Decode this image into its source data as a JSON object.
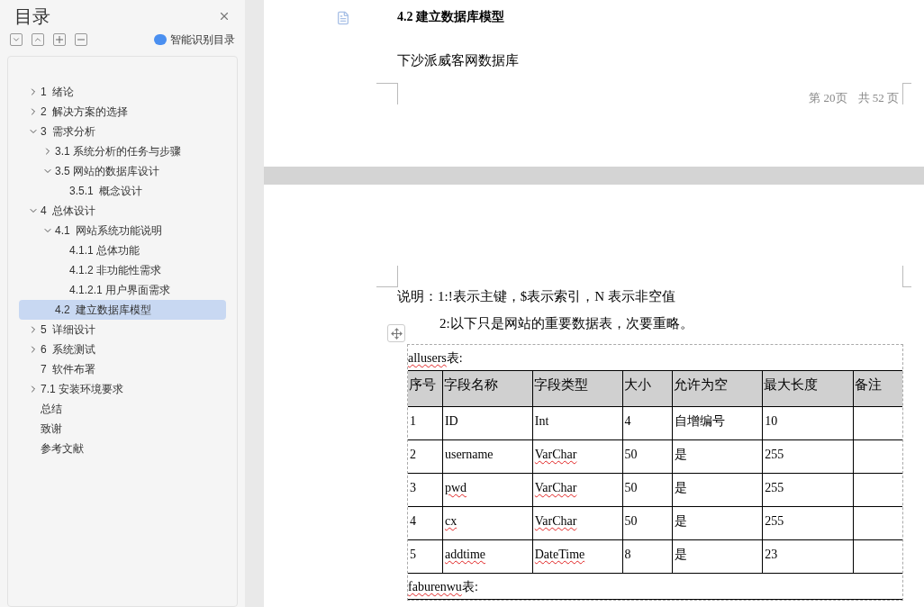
{
  "sidebar": {
    "title": "目录",
    "smart_toc_button": "智能识别目录",
    "toc": [
      {
        "label": "1  绪论",
        "expanded": false,
        "selected": false
      },
      {
        "label": "2  解决方案的选择",
        "expanded": false,
        "selected": false
      },
      {
        "label": "3  需求分析",
        "expanded": true,
        "selected": false,
        "children": [
          {
            "label": "3.1 系统分析的任务与步骤",
            "expanded": false,
            "selected": false
          },
          {
            "label": "3.5 网站的数据库设计",
            "expanded": true,
            "selected": false,
            "children": [
              {
                "label": "3.5.1  概念设计",
                "selected": false
              }
            ]
          }
        ]
      },
      {
        "label": "4  总体设计",
        "expanded": true,
        "selected": false,
        "children": [
          {
            "label": "4.1  网站系统功能说明",
            "expanded": true,
            "selected": false,
            "children": [
              {
                "label": "4.1.1 总体功能",
                "selected": false
              },
              {
                "label": "4.1.2 非功能性需求",
                "selected": false
              },
              {
                "label": "4.1.2.1 用户界面需求",
                "selected": false
              }
            ]
          },
          {
            "label": "4.2  建立数据库模型",
            "selected": true
          }
        ]
      },
      {
        "label": "5  详细设计",
        "expanded": false,
        "selected": false
      },
      {
        "label": "6  系统测试",
        "expanded": false,
        "selected": false
      },
      {
        "label": "7  软件布署",
        "selected": false
      },
      {
        "label": "7.1 安装环境要求",
        "expanded": false,
        "selected": false
      },
      {
        "label": "总结",
        "selected": false
      },
      {
        "label": "致谢",
        "selected": false
      },
      {
        "label": "参考文献",
        "selected": false
      }
    ]
  },
  "page_1": {
    "heading": "4.2 建立数据库模型",
    "paragraph": "下沙派威客网数据库",
    "page_number": "第 20页",
    "page_total": "共 52 页"
  },
  "page_2": {
    "notes": [
      "说明：1:!表示主键，$表示索引，N 表示非空值",
      "2:以下只是网站的重要数据表，次要重略。"
    ],
    "table_caption": {
      "name": "allusers",
      "flagged": true,
      "suffix": "表:"
    },
    "columns": [
      "序号",
      "字段名称",
      "字段类型",
      "大小",
      "允许为空",
      "最大长度",
      "备注"
    ],
    "rows": [
      [
        {
          "text": "1",
          "flagged": false
        },
        {
          "text": "ID",
          "flagged": false
        },
        {
          "text": "Int",
          "flagged": false
        },
        {
          "text": "4",
          "flagged": false
        },
        {
          "text": "自增编号",
          "flagged": false
        },
        {
          "text": "10",
          "flagged": false
        }
      ],
      [
        {
          "text": "2",
          "flagged": false
        },
        {
          "text": "username",
          "flagged": false
        },
        {
          "text": "VarChar",
          "flagged": true
        },
        {
          "text": "50",
          "flagged": false
        },
        {
          "text": "是",
          "flagged": false
        },
        {
          "text": "255",
          "flagged": false
        }
      ],
      [
        {
          "text": "3",
          "flagged": false
        },
        {
          "text": "pwd",
          "flagged": true
        },
        {
          "text": "VarChar",
          "flagged": true
        },
        {
          "text": "50",
          "flagged": false
        },
        {
          "text": "是",
          "flagged": false
        },
        {
          "text": "255",
          "flagged": false
        }
      ],
      [
        {
          "text": "4",
          "flagged": false
        },
        {
          "text": "cx",
          "flagged": true
        },
        {
          "text": "VarChar",
          "flagged": true
        },
        {
          "text": "50",
          "flagged": false
        },
        {
          "text": "是",
          "flagged": false
        },
        {
          "text": "255",
          "flagged": false
        }
      ],
      [
        {
          "text": "5",
          "flagged": false
        },
        {
          "text": "addtime",
          "flagged": true
        },
        {
          "text": "DateTime",
          "flagged": true
        },
        {
          "text": "8",
          "flagged": false
        },
        {
          "text": "是",
          "flagged": false
        },
        {
          "text": "23",
          "flagged": false
        }
      ]
    ],
    "next_caption": {
      "name": "faburenwu",
      "flagged": true,
      "suffix": "表:"
    }
  }
}
